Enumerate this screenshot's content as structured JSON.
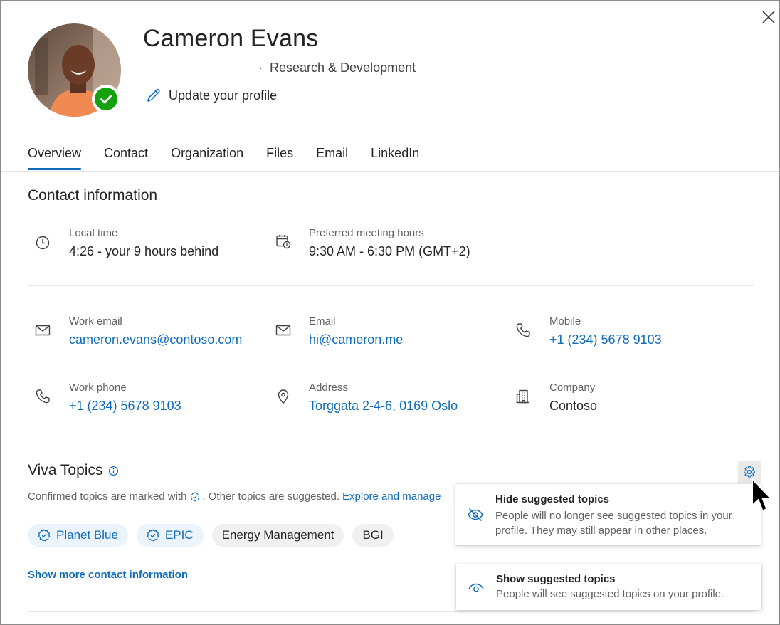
{
  "profile": {
    "name": "Cameron Evans",
    "department": "Research & Development",
    "update_label": "Update your profile",
    "presence": "available"
  },
  "tabs": [
    {
      "label": "Overview",
      "active": true
    },
    {
      "label": "Contact"
    },
    {
      "label": "Organization"
    },
    {
      "label": "Files"
    },
    {
      "label": "Email"
    },
    {
      "label": "LinkedIn"
    }
  ],
  "contact": {
    "title": "Contact information",
    "local_time": {
      "label": "Local time",
      "value": "4:26 - your 9 hours behind",
      "icon": "clock-icon"
    },
    "meeting_hours": {
      "label": "Preferred meeting hours",
      "value": "9:30 AM - 6:30 PM (GMT+2)",
      "icon": "calendar-clock-icon"
    },
    "work_email": {
      "label": "Work email",
      "value": "cameron.evans@contoso.com",
      "icon": "mail-icon"
    },
    "email": {
      "label": "Email",
      "value": "hi@cameron.me",
      "icon": "mail-icon"
    },
    "mobile": {
      "label": "Mobile",
      "value": "+1 (234) 5678 9103",
      "icon": "phone-icon"
    },
    "work_phone": {
      "label": "Work phone",
      "value": "+1 (234) 5678 9103",
      "icon": "phone-icon"
    },
    "address": {
      "label": "Address",
      "value": "Torggata 2-4-6, 0169 Oslo",
      "icon": "location-pin-icon"
    },
    "company": {
      "label": "Company",
      "value": "Contoso",
      "icon": "building-icon"
    }
  },
  "viva": {
    "title": "Viva Topics",
    "desc_before": "Confirmed topics are marked with",
    "desc_after": ". Other topics are suggested.",
    "desc_link": "Explore and manage",
    "topics": [
      {
        "label": "Planet Blue",
        "confirmed": true
      },
      {
        "label": "EPIC",
        "confirmed": true
      },
      {
        "label": "Energy Management",
        "confirmed": false
      },
      {
        "label": "BGI",
        "confirmed": false
      }
    ]
  },
  "show_more": "Show more contact information",
  "menu": {
    "hide": {
      "title": "Hide suggested topics",
      "desc": "People will no longer see suggested topics in your profile. They may still appear in other places."
    },
    "show": {
      "title": "Show suggested topics",
      "desc": "People will see suggested topics on your profile."
    }
  },
  "colors": {
    "accent": "#0f6cbd",
    "presence_green": "#13a10e",
    "chip_confirmed_bg": "#ebf3fc"
  }
}
